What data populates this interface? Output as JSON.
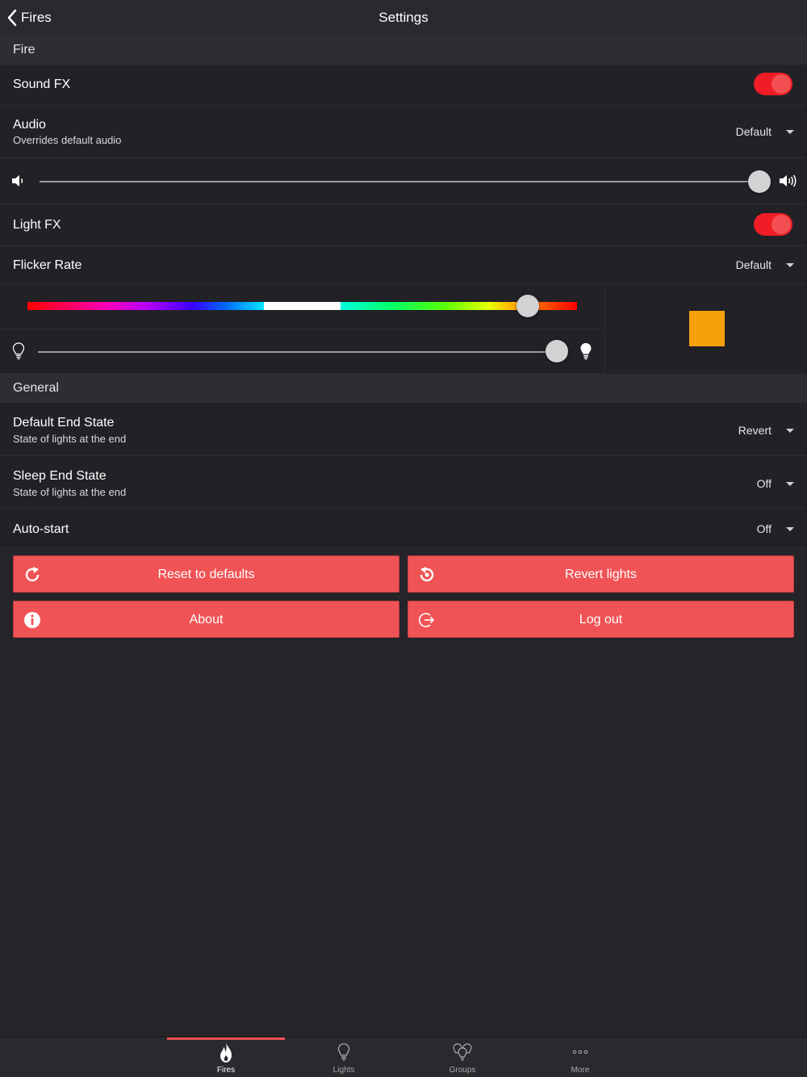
{
  "nav": {
    "back_label": "Fires",
    "title": "Settings"
  },
  "sections": {
    "fire": "Fire",
    "general": "General"
  },
  "fire": {
    "sound_fx": {
      "label": "Sound FX",
      "enabled": true
    },
    "audio": {
      "label": "Audio",
      "sublabel": "Overrides default audio",
      "value": "Default"
    },
    "volume": {
      "level": 1.0
    },
    "light_fx": {
      "label": "Light FX",
      "enabled": true
    },
    "flicker_rate": {
      "label": "Flicker Rate",
      "value": "Default"
    },
    "hue": {
      "level": 0.91
    },
    "brightness": {
      "level": 1.0
    },
    "color_swatch": "#f7a00b"
  },
  "general": {
    "default_end_state": {
      "label": "Default End State",
      "sublabel": "State of lights at the end",
      "value": "Revert"
    },
    "sleep_end_state": {
      "label": "Sleep End State",
      "sublabel": "State of lights at the end",
      "value": "Off"
    },
    "auto_start": {
      "label": "Auto-start",
      "value": "Off"
    }
  },
  "buttons": {
    "reset": {
      "label": "Reset to defaults",
      "icon": "reset-icon"
    },
    "revert": {
      "label": "Revert lights",
      "icon": "revert-icon"
    },
    "about": {
      "label": "About",
      "icon": "info-icon"
    },
    "logout": {
      "label": "Log out",
      "icon": "logout-icon"
    }
  },
  "tabs": [
    {
      "label": "Fires",
      "icon": "flame-icon",
      "active": true
    },
    {
      "label": "Lights",
      "icon": "bulb-icon",
      "active": false
    },
    {
      "label": "Groups",
      "icon": "bulbs-group-icon",
      "active": false
    },
    {
      "label": "More",
      "icon": "more-dots-icon",
      "active": false
    }
  ],
  "colors": {
    "accent": "#f05355",
    "toggle_on": "#f01d26",
    "background": "#252429"
  }
}
